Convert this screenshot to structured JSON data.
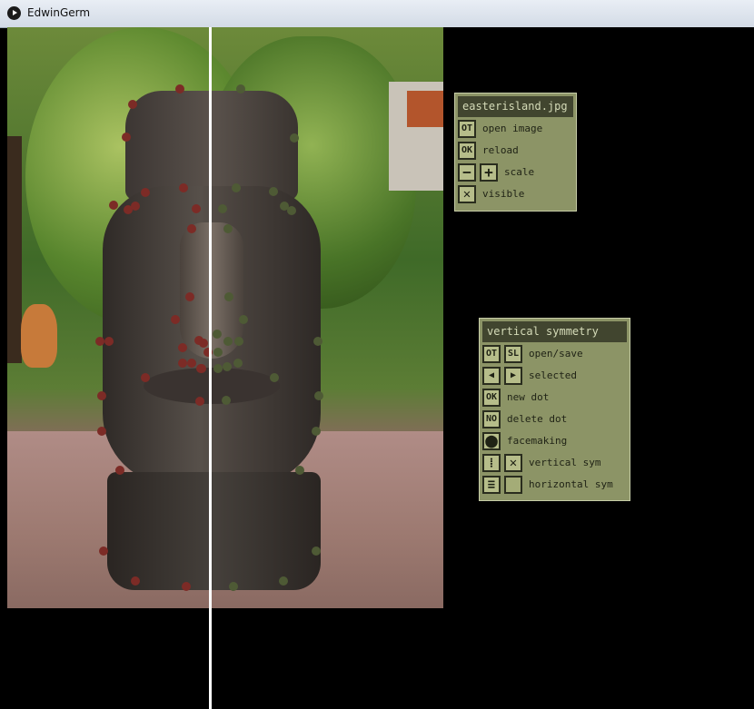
{
  "window": {
    "title": "EdwinGerm"
  },
  "image_panel": {
    "title": "easterisland.jpg",
    "rows": [
      {
        "icon": "OT",
        "label": "open image"
      },
      {
        "icon": "OK",
        "label": "reload"
      },
      {
        "icon_minus": "−",
        "icon_plus": "+",
        "label": "scale"
      },
      {
        "icon": "✕",
        "label": "visible"
      }
    ]
  },
  "symmetry_panel": {
    "title": "vertical symmetry",
    "rows": [
      {
        "icon1": "OT",
        "icon2": "SL",
        "label": "open/save"
      },
      {
        "icon1": "◀",
        "icon2": "▶",
        "label": "selected"
      },
      {
        "icon1": "OK",
        "label": "new dot"
      },
      {
        "icon1": "NO",
        "label": "delete dot"
      },
      {
        "icon1": "⬤",
        "label": "facemaking"
      },
      {
        "icon1": "⁞",
        "icon2": "✕",
        "label": "vertical sym"
      },
      {
        "icon1": "≡",
        "icon2": "",
        "label": "horizontal sym"
      }
    ]
  },
  "colors": {
    "panel_bg": "#8c9466",
    "panel_title_bg": "#41452f",
    "dot_left": "#7c2b26",
    "dot_right": "#4e5a35"
  }
}
